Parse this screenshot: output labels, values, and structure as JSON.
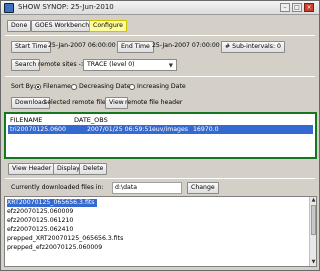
{
  "window": {
    "title": "SHOW SYNOP: 25-Jun-2010"
  },
  "toolbar": {
    "done": "Done",
    "goes_workbench": "GOES Workbench",
    "configure": "Configure"
  },
  "time": {
    "start_label": "Start Time",
    "start_value": "25-Jan-2007 06:00:00.000",
    "end_label": "End Time",
    "end_value": "25-Jan-2007 07:00:00.000",
    "subintervals_label": "# Sub-intervals: 0"
  },
  "search": {
    "button": "Search",
    "remote_sites_label": "remote sites ->",
    "site_selected": "TRACE (level 0)"
  },
  "sort": {
    "label": "Sort By:",
    "options": [
      "Filename",
      "Decreasing Date",
      "Increasing Date"
    ],
    "selected": "Filename"
  },
  "actions": {
    "download": "Download",
    "selected_remote": "selected remote file(s)",
    "view": "View",
    "remote_header": "remote file header"
  },
  "results": {
    "columns": [
      "FILENAME",
      "DATE_OBS"
    ],
    "rows": [
      {
        "filename": "tri20070125.0600",
        "date_obs": "2007/01/25 06:59:51",
        "path": "euv/images",
        "size": "16970.0"
      }
    ]
  },
  "local_actions": {
    "view_header": "View Header",
    "display": "Display",
    "delete": "Delete"
  },
  "download_dir": {
    "label": "Currently downloaded files in:",
    "value": "d:\\data",
    "change": "Change"
  },
  "local_files": [
    "XRT20070125_065656.3.fits",
    "efz20070125.060009",
    "efz20070125.061210",
    "efz20070125.062410",
    "prepped_XRT20070125_065656.3.fits",
    "prepped_efz20070125.060009"
  ],
  "colors": {
    "selection": "#3469d1",
    "results_border": "#14761e",
    "configure_active": "#fffe9a"
  }
}
